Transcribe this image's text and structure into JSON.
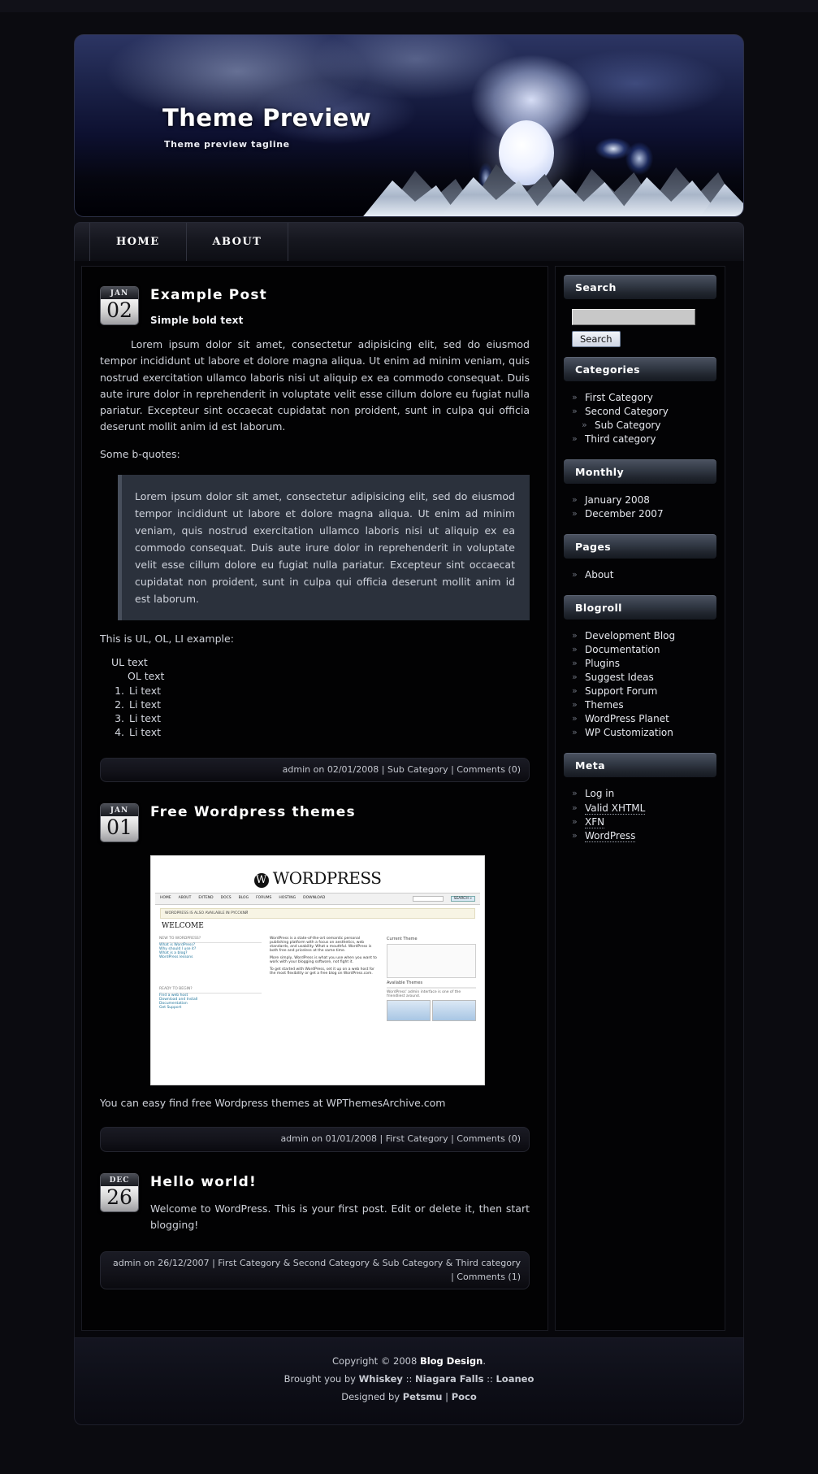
{
  "site": {
    "title": "Theme Preview",
    "tagline": "Theme preview tagline"
  },
  "nav": {
    "items": [
      {
        "label": "HOME"
      },
      {
        "label": "ABOUT"
      }
    ]
  },
  "posts": [
    {
      "date_month": "JAN",
      "date_day": "02",
      "title": "Example Post",
      "subtitle": "Simple bold text",
      "paragraph": "Lorem ipsum dolor sit amet, consectetur adipisicing elit, sed do eiusmod tempor incididunt ut labore et dolore magna aliqua. Ut enim ad minim veniam, quis nostrud exercitation ullamco laboris nisi ut aliquip ex ea commodo consequat. Duis aute irure dolor in reprehenderit in voluptate velit esse cillum dolore eu fugiat nulla pariatur. Excepteur sint occaecat cupidatat non proident, sunt in culpa qui officia deserunt mollit anim id est laborum.",
      "quote_intro": "Some b-quotes:",
      "quote": "Lorem ipsum dolor sit amet, consectetur adipisicing elit, sed do eiusmod tempor incididunt ut labore et dolore magna aliqua. Ut enim ad minim veniam, quis nostrud exercitation ullamco laboris nisi ut aliquip ex ea commodo consequat. Duis aute irure dolor in reprehenderit in voluptate velit esse cillum dolore eu fugiat nulla pariatur. Excepteur sint occaecat cupidatat non proident, sunt in culpa qui officia deserunt mollit anim id est laborum.",
      "list_intro": "This is UL, OL, LI example:",
      "ul_text": "UL text",
      "ol_text": "OL text",
      "li_items": [
        "Li text",
        "Li text",
        "Li text",
        "Li text"
      ],
      "meta": "admin on 02/01/2008 | Sub Category | Comments (0)"
    },
    {
      "date_month": "JAN",
      "date_day": "01",
      "title": "Free Wordpress themes",
      "caption": "You can easy find free Wordpress themes at WPThemesArchive.com",
      "meta": "admin on 01/01/2008 | First Category | Comments (0)",
      "screenshot": {
        "logo": "WORDPRESS",
        "nav": [
          "HOME",
          "ABOUT",
          "EXTEND",
          "DOCS",
          "BLOG",
          "FORUMS",
          "HOSTING",
          "DOWNLOAD"
        ],
        "search_button": "SEARCH »",
        "notice": "WORDPRESS IS ALSO AVAILABLE IN PYCCKNЙ",
        "welcome": "WELCOME",
        "left_head1": "NEW TO WORDPRESS?",
        "left_links1": [
          "What is WordPress?",
          "Why should I use it?",
          "What is a blog?",
          "WordPress lessons"
        ],
        "left_head2": "READY TO BEGIN?",
        "left_links2": [
          "Find a web host",
          "Download and Install",
          "Documentation",
          "Get Support"
        ],
        "body1": "WordPress is a state-of-the-art semantic personal publishing platform with a focus on aesthetics, web standards, and usability. What a mouthful. WordPress is both free and priceless at the same time.",
        "body2": "More simply, WordPress is what you use when you want to work with your blogging software, not fight it.",
        "body3": "To get started with WordPress, set it up on a web host for the most flexibility or get a free blog on WordPress.com.",
        "right_head": "Current Theme",
        "right_head2": "Available Themes",
        "right_caption": "WordPress' admin interface is one of the friendliest around."
      }
    },
    {
      "date_month": "DEC",
      "date_day": "26",
      "title": "Hello world!",
      "paragraph": "Welcome to WordPress. This is your first post. Edit or delete it, then start blogging!",
      "meta": "admin on 26/12/2007 | First Category & Second Category & Sub Category & Third category | Comments (1)"
    }
  ],
  "sidebar": {
    "search": {
      "title": "Search",
      "value": "",
      "placeholder": "",
      "button": "Search"
    },
    "categories": {
      "title": "Categories",
      "items": [
        {
          "label": "First Category",
          "nested": false
        },
        {
          "label": "Second Category",
          "nested": false
        },
        {
          "label": "Sub Category",
          "nested": true
        },
        {
          "label": "Third category",
          "nested": false
        }
      ]
    },
    "monthly": {
      "title": "Monthly",
      "items": [
        {
          "label": "January 2008"
        },
        {
          "label": "December 2007"
        }
      ]
    },
    "pages": {
      "title": "Pages",
      "items": [
        {
          "label": "About"
        }
      ]
    },
    "blogroll": {
      "title": "Blogroll",
      "items": [
        {
          "label": "Development Blog"
        },
        {
          "label": "Documentation"
        },
        {
          "label": "Plugins"
        },
        {
          "label": "Suggest Ideas"
        },
        {
          "label": "Support Forum"
        },
        {
          "label": "Themes"
        },
        {
          "label": "WordPress Planet"
        },
        {
          "label": "WP Customization"
        }
      ]
    },
    "meta": {
      "title": "Meta",
      "items": [
        {
          "label": "Log in",
          "dotted": false
        },
        {
          "label": "Valid XHTML",
          "dotted": true
        },
        {
          "label": "XFN",
          "dotted": true
        },
        {
          "label": "WordPress",
          "dotted": false
        }
      ]
    }
  },
  "footer": {
    "line1_pre": "Copyright © 2008 ",
    "line1_strong": "Blog Design",
    "line1_post": ".",
    "line2_pre": "Brought you by ",
    "line2_a": "Whiskey",
    "line2_mid1": " :: ",
    "line2_b": "Niagara Falls",
    "line2_mid2": " :: ",
    "line2_c": "Loaneo",
    "line3_pre": "Designed by ",
    "line3_a": "Petsmu",
    "line3_mid": " | ",
    "line3_b": "Poco"
  }
}
